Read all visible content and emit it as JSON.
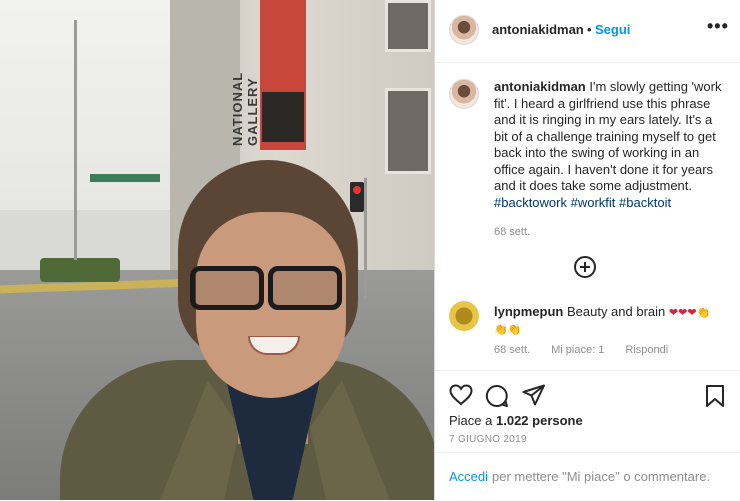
{
  "photo": {
    "building_text": "NATIONAL GALLERY"
  },
  "header": {
    "username": "antoniakidman",
    "separator": "•",
    "follow_label": "Segui",
    "more_label": "•••"
  },
  "post": {
    "caption_user": "antoniakidman",
    "caption_text": "I'm slowly getting 'work fit'. I heard a girlfriend use this phrase and it is ringing in my ears lately. It's a bit of a challenge training myself to get back into the swing of working in an office again. I haven't done it for years and it does take some adjustment.",
    "hashtags": [
      "#backtowork",
      "#workfit",
      "#backtoit"
    ],
    "caption_time": "68 sett."
  },
  "comment": {
    "user": "lynpmepun",
    "text": "Beauty and brain",
    "emojis": "❤❤❤👏👏👏",
    "time": "68 sett.",
    "likes": "Mi piace: 1",
    "reply": "Rispondi"
  },
  "actions": {
    "like_icon": "heart-icon",
    "comment_icon": "speech-bubble-icon",
    "share_icon": "paper-plane-icon",
    "save_icon": "bookmark-icon"
  },
  "likes": {
    "prefix": "Piace a",
    "count": "1.022 persone"
  },
  "date": "7 GIUGNO 2019",
  "footer": {
    "login_label": "Accedi",
    "login_text": "per mettere \"Mi piace\" o commentare."
  },
  "colors": {
    "accent": "#0095f6",
    "hashtag": "#00376b",
    "muted": "#8e8e8e"
  }
}
